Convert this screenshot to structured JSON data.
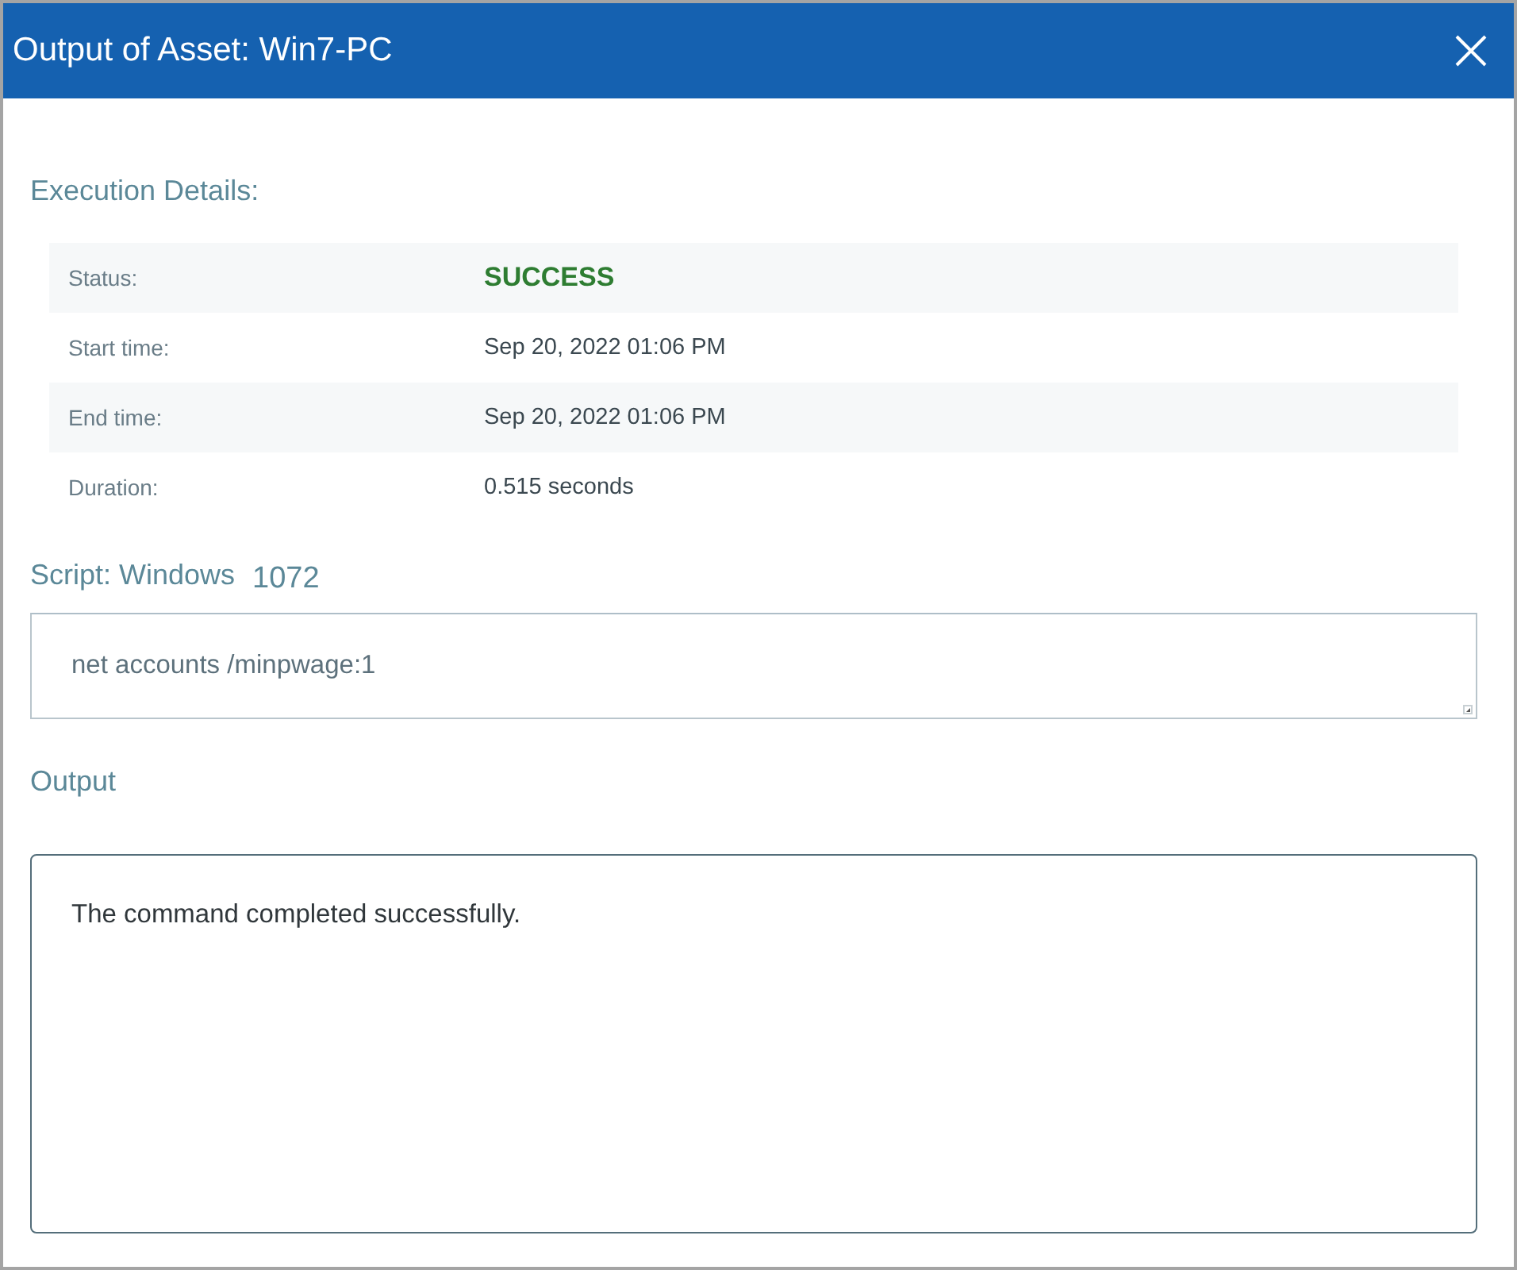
{
  "dialog": {
    "title": "Output of Asset: Win7-PC"
  },
  "execution_details": {
    "heading": "Execution Details:",
    "rows": [
      {
        "label": "Status:",
        "value": "SUCCESS",
        "kind": "status"
      },
      {
        "label": "Start time:",
        "value": "Sep 20, 2022 01:06 PM",
        "kind": "text"
      },
      {
        "label": "End time:",
        "value": "Sep 20, 2022 01:06 PM",
        "kind": "text"
      },
      {
        "label": "Duration:",
        "value": "0.515 seconds",
        "kind": "text"
      }
    ]
  },
  "script": {
    "heading": "Script: Windows",
    "number": "1072",
    "value": "net accounts /minpwage:1"
  },
  "output": {
    "heading": "Output",
    "value": "The command completed successfully."
  }
}
